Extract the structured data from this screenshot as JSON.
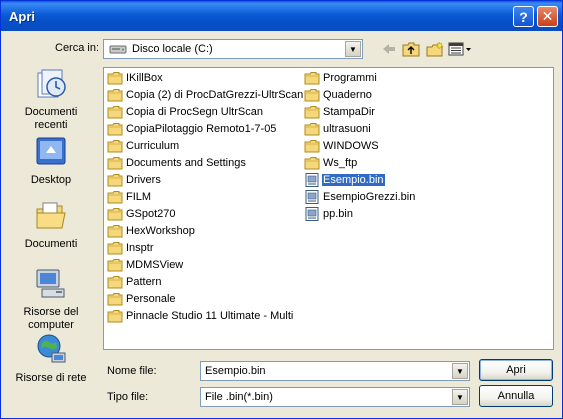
{
  "window": {
    "title": "Apri",
    "help_glyph": "?",
    "close_glyph": "✕"
  },
  "lookin": {
    "label": "Cerca in:",
    "value": "Disco locale (C:)"
  },
  "toolbar": {
    "icons": [
      "back-icon",
      "up-folder-icon",
      "new-folder-icon",
      "view-menu-icon"
    ]
  },
  "places": [
    {
      "label": "Documenti recenti",
      "icon": "recent-documents-icon"
    },
    {
      "label": "Desktop",
      "icon": "desktop-icon"
    },
    {
      "label": "Documenti",
      "icon": "my-documents-icon"
    },
    {
      "label": "Risorse del computer",
      "icon": "my-computer-icon"
    },
    {
      "label": "Risorse di rete",
      "icon": "network-icon"
    }
  ],
  "files_col1": [
    "IKillBox",
    "Copia (2) di ProcDatGrezzi-UltrScan",
    "Copia di ProcSegn UltrScan",
    "CopiaPilotaggio Remoto1-7-05",
    "Curriculum",
    "Documents and Settings",
    "Drivers",
    "FILM",
    "GSpot270",
    "HexWorkshop",
    "Insptr",
    "MDMSView",
    "Pattern",
    "Personale",
    "Pinnacle Studio 11 Ultimate - Multi"
  ],
  "files_col2": [
    {
      "name": "Programmi",
      "type": "folder"
    },
    {
      "name": "Quaderno",
      "type": "folder"
    },
    {
      "name": "StampaDir",
      "type": "folder"
    },
    {
      "name": "ultrasuoni",
      "type": "folder"
    },
    {
      "name": "WINDOWS",
      "type": "folder"
    },
    {
      "name": "Ws_ftp",
      "type": "folder"
    },
    {
      "name": "Esempio.bin",
      "type": "file",
      "selected": true
    },
    {
      "name": "EsempioGrezzi.bin",
      "type": "file"
    },
    {
      "name": "pp.bin",
      "type": "file"
    }
  ],
  "filename": {
    "label": "Nome file:",
    "value": "Esempio.bin"
  },
  "filetype": {
    "label": "Tipo file:",
    "value": "File .bin(*.bin)"
  },
  "buttons": {
    "open": "Apri",
    "cancel": "Annulla"
  },
  "colors": {
    "titlebar": "#0b5bd6",
    "selection": "#316ac5",
    "dialog_bg": "#ece9d8",
    "folder": "#f5d77c"
  }
}
